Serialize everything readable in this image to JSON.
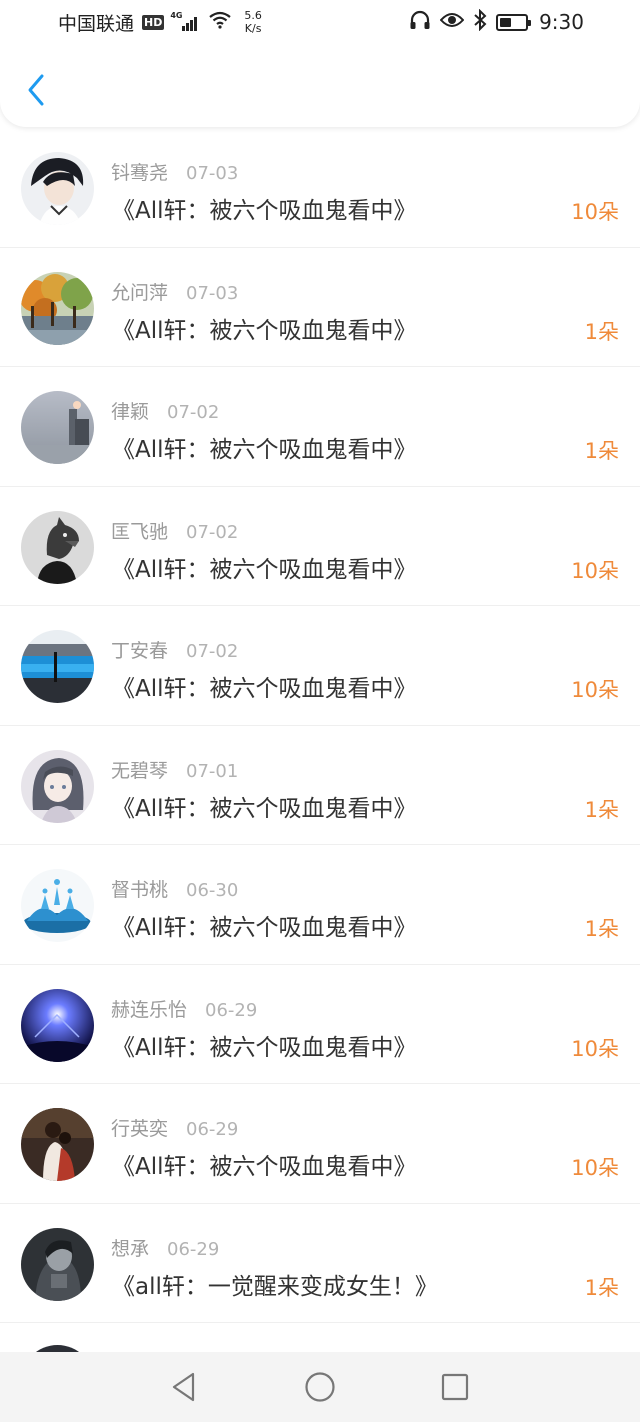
{
  "status_bar": {
    "carrier": "中国联通",
    "hd": "HD",
    "network": "4G",
    "speed_value": "5.6",
    "speed_unit": "K/s",
    "battery_level": 0.45,
    "time": "9:30"
  },
  "header": {
    "back_icon": "chevron-left-icon",
    "accent_color": "#1e9bf0"
  },
  "rewards": [
    {
      "user": "钭骞尧",
      "date": "07-03",
      "title": "《All轩：被六个吸血鬼看中》",
      "amount": "10朵",
      "avatar": "anime-boy"
    },
    {
      "user": "允问萍",
      "date": "07-03",
      "title": "《All轩：被六个吸血鬼看中》",
      "amount": "1朵",
      "avatar": "autumn-trees"
    },
    {
      "user": "律颖",
      "date": "07-02",
      "title": "《All轩：被六个吸血鬼看中》",
      "amount": "1朵",
      "avatar": "misty-street"
    },
    {
      "user": "匡飞驰",
      "date": "07-02",
      "title": "《All轩：被六个吸血鬼看中》",
      "amount": "10朵",
      "avatar": "wolf-mask"
    },
    {
      "user": "丁安春",
      "date": "07-02",
      "title": "《All轩：被六个吸血鬼看中》",
      "amount": "10朵",
      "avatar": "blue-pool"
    },
    {
      "user": "无碧琴",
      "date": "07-01",
      "title": "《All轩：被六个吸血鬼看中》",
      "amount": "1朵",
      "avatar": "anime-girl"
    },
    {
      "user": "督书桃",
      "date": "06-30",
      "title": "《All轩：被六个吸血鬼看中》",
      "amount": "1朵",
      "avatar": "water-splash"
    },
    {
      "user": "赫连乐怡",
      "date": "06-29",
      "title": "《All轩：被六个吸血鬼看中》",
      "amount": "10朵",
      "avatar": "concert-stage"
    },
    {
      "user": "行英奕",
      "date": "06-29",
      "title": "《All轩：被六个吸血鬼看中》",
      "amount": "10朵",
      "avatar": "couple-dark"
    },
    {
      "user": "想承",
      "date": "06-29",
      "title": "《all轩：一觉醒来变成女生！》",
      "amount": "1朵",
      "avatar": "sketch-portrait"
    }
  ],
  "colors": {
    "amount": "#ef8a3a",
    "name": "#9a9a9a",
    "title": "#333333"
  },
  "nav": {
    "back_icon": "triangle-back-icon",
    "home_icon": "circle-home-icon",
    "recents_icon": "square-recents-icon"
  }
}
